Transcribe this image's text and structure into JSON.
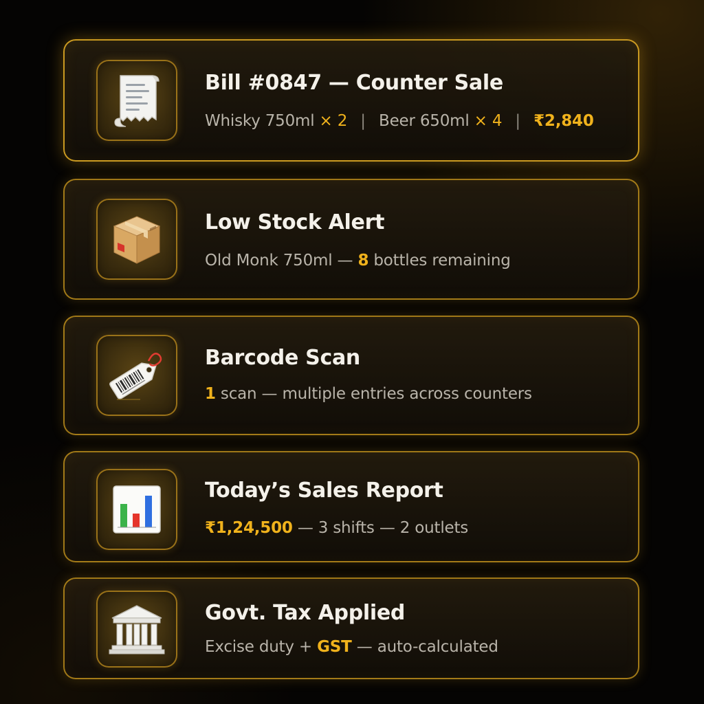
{
  "cards": [
    {
      "icon": "receipt-icon",
      "title": "Bill #0847 — Counter Sale",
      "item1_name": "Whisky 750ml",
      "item1_mult": "× 2",
      "separator": "|",
      "item2_name": "Beer 650ml",
      "item2_mult": "× 4",
      "total": "₹2,840"
    },
    {
      "icon": "cardboard-box-icon",
      "title": "Low Stock Alert",
      "sub_before": "Old Monk 750ml — ",
      "count": "8",
      "sub_after": " bottles remaining"
    },
    {
      "icon": "barcode-tag-icon",
      "title": "Barcode Scan",
      "count": "1",
      "sub_after": " scan — multiple entries across counters"
    },
    {
      "icon": "bar-chart-icon",
      "title": "Today’s Sales Report",
      "amount": "₹1,24,500",
      "sub_after": " — 3 shifts — 2 outlets"
    },
    {
      "icon": "government-building-icon",
      "title": "Govt. Tax Applied",
      "sub_before": "Excise duty + ",
      "highlight": "GST",
      "sub_after": " — auto-calculated"
    }
  ],
  "colors": {
    "accent": "#f0b21c",
    "border": "#c9971c",
    "title": "#f4f1ea",
    "subtitle": "#b9b4aa",
    "background": "#050403"
  }
}
